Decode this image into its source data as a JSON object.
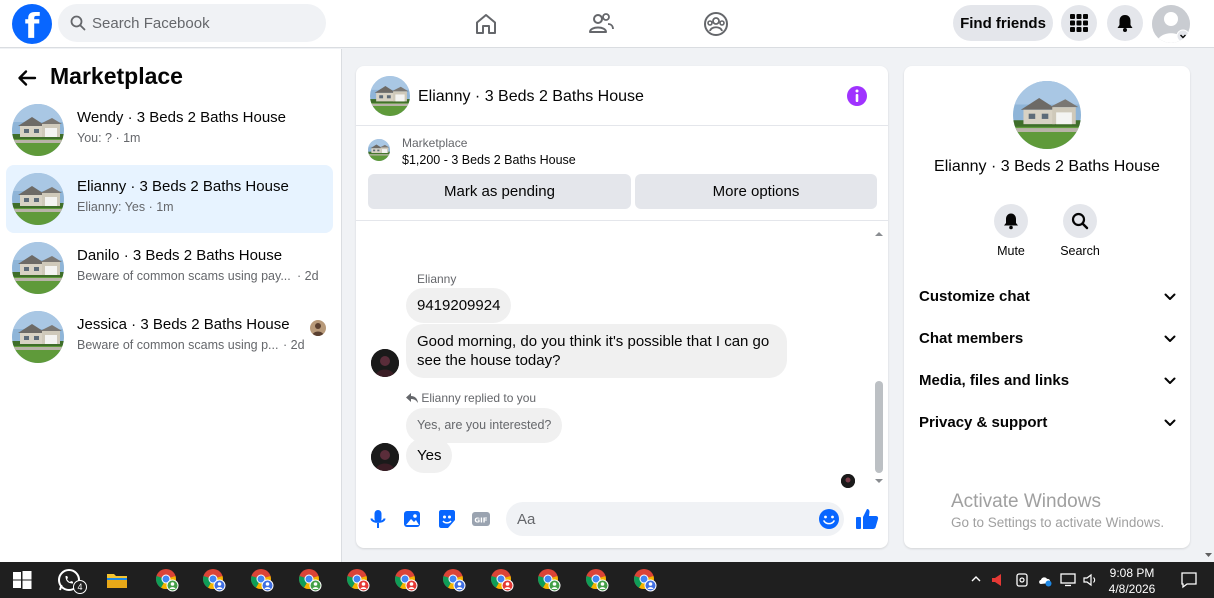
{
  "topbar": {
    "search_placeholder": "Search Facebook",
    "find_friends_label": "Find friends",
    "logo_icon": "facebook-logo",
    "nav_icons": [
      "home-icon",
      "friends-icon",
      "groups-icon"
    ],
    "right_icons": [
      "menu-grid-icon",
      "notifications-bell-icon",
      "account-avatar"
    ]
  },
  "sidebar": {
    "title": "Marketplace",
    "conversations": [
      {
        "title": "Wendy · 3 Beds 2 Baths House",
        "subtitle": "You: ? · 1m",
        "time": "",
        "active": false
      },
      {
        "title": "Elianny · 3 Beds 2 Baths House",
        "subtitle": "Elianny: Yes · 1m",
        "time": "",
        "active": true
      },
      {
        "title": "Danilo · 3 Beds 2 Baths House",
        "subtitle": "Beware of common scams using pay...",
        "time": "· 2d",
        "active": false
      },
      {
        "title": "Jessica · 3 Beds 2 Baths House",
        "subtitle": "Beware of common scams using p...",
        "time": "· 2d",
        "active": false
      }
    ]
  },
  "chat": {
    "header_title": "Elianny · 3 Beds 2 Baths House",
    "listing": {
      "label": "Marketplace",
      "price_title": "$1,200 - 3 Beds 2 Baths House",
      "mark_pending": "Mark as pending",
      "more_options": "More options"
    },
    "messages": {
      "sender_name": "Elianny",
      "msg1": "9419209924",
      "msg2_line1": "Good morning, do you think it's possible that I can go",
      "msg2_line2": "see the house today?",
      "reply_label": "Elianny replied to you",
      "quoted": "Yes, are you interested?",
      "msg3": "Yes"
    },
    "composer_placeholder": "Aa"
  },
  "info_panel": {
    "title": "Elianny · 3 Beds 2 Baths House",
    "mute_label": "Mute",
    "search_label": "Search",
    "sections": [
      "Customize chat",
      "Chat members",
      "Media, files and links",
      "Privacy & support"
    ]
  },
  "watermark": {
    "line1": "Activate Windows",
    "line2": "Go to Settings to activate Windows."
  },
  "taskbar": {
    "whatsapp_badge": "4",
    "time": "9:08 PM",
    "date": "4/8/2026"
  },
  "colors": {
    "accent": "#0866ff",
    "messenger_purple": "#a033ff",
    "active_row": "#e7f3ff"
  }
}
